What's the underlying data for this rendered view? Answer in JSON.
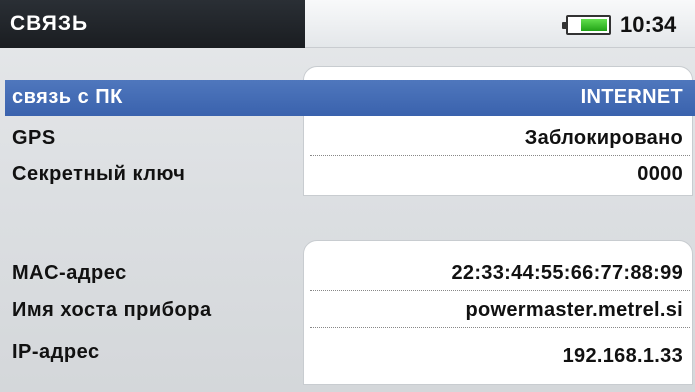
{
  "header": {
    "title": "СВЯЗЬ",
    "time": "10:34",
    "battery_level": 0.65
  },
  "settings": [
    {
      "label": "связь с ПК",
      "value": "INTERNET",
      "selected": true
    },
    {
      "label": "GPS",
      "value": "Заблокировано"
    },
    {
      "label": "Секретный ключ",
      "value": "0000"
    }
  ],
  "network_info": [
    {
      "label": "MAC-адрес",
      "value": "22:33:44:55:66:77:88:99"
    },
    {
      "label": "Имя хоста прибора",
      "value": "powermaster.metrel.si"
    },
    {
      "label": "IP-адрес",
      "value": "192.168.1.33"
    }
  ],
  "colors": {
    "selection": "#4a72b8",
    "title_bar": "#1f2328",
    "battery": "#2fbf20"
  }
}
